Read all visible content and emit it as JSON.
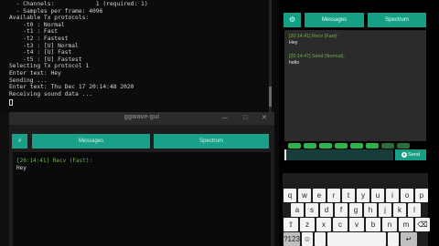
{
  "terminal": {
    "lines": [
      "  - Channels:            1 (required: 1)",
      "  - Samples per frame: 4096",
      "Available Tx protocols:",
      "    -t0 : Normal",
      "    -t1 : Fast",
      "    -t2 : Fastest",
      "    -t3 : [U] Normal",
      "    -t4 : [U] Fast",
      "    -t5 : [U] Fastest",
      "Selecting Tx protocol 1",
      "Enter text: Hey",
      "Sending ...",
      "Enter text: Thu Dec 17 20:14:48 2020",
      "Receiving sound data ..."
    ]
  },
  "gui": {
    "title": "ggwave-gui",
    "min": "—",
    "max": "□",
    "close": "✕",
    "menu_icon": "#",
    "tabs": [
      "Messages",
      "Spectrum"
    ],
    "log": [
      {
        "header": "[20:14:41] Recv (Fast):",
        "msg": "Hey"
      }
    ]
  },
  "phone": {
    "nav_icon": "⚙",
    "tabs": [
      "Messages",
      "Spectrum"
    ],
    "log": [
      {
        "header": "[20:14:41] Recv (Fast):",
        "msg": "Hey"
      },
      {
        "header": "[20:14:47] Send (Normal):",
        "msg": "hello"
      }
    ],
    "send_label": "Send",
    "keyboard": {
      "row1": [
        "q",
        "w",
        "e",
        "r",
        "t",
        "y",
        "u",
        "i",
        "o",
        "p"
      ],
      "row2": [
        "a",
        "s",
        "d",
        "f",
        "g",
        "h",
        "j",
        "k",
        "l"
      ],
      "row3": [
        "⇧",
        "z",
        "x",
        "c",
        "v",
        "b",
        "n",
        "m",
        "⌫"
      ],
      "row4": [
        "?123",
        "☺",
        "",
        "space",
        "",
        "↵"
      ]
    }
  },
  "colors": {
    "accent": "#179f86",
    "recv": "#6fb34a"
  }
}
